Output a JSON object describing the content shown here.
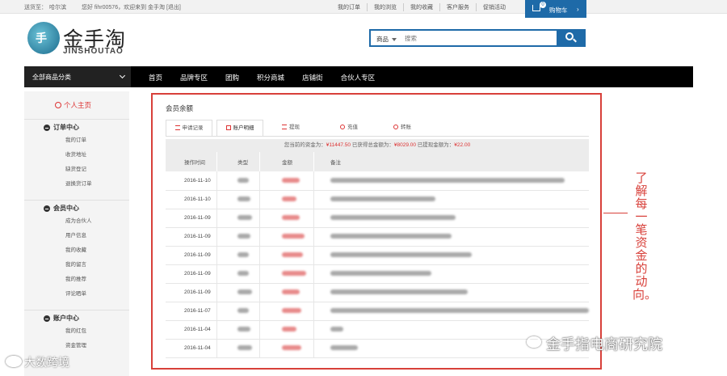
{
  "topbar": {
    "delivery_label": "送货至：",
    "location": "哈尔滨",
    "greeting": "您好 fihr00576，欢迎来到 金手淘 [退出]",
    "links": [
      "我的订单",
      "我的浏览",
      "我的收藏",
      "客户服务",
      "促销活动"
    ],
    "cart_label": "购物车",
    "cart_count": "0"
  },
  "logo": {
    "cn": "金手淘",
    "en": "JINSHOUTAO",
    "badge": "手"
  },
  "search": {
    "category": "商品",
    "placeholder": "搜索"
  },
  "nav": {
    "all_categories": "全部商品分类",
    "items": [
      "首页",
      "品牌专区",
      "团购",
      "积分商城",
      "店铺街",
      "合伙人专区"
    ]
  },
  "sidebar": {
    "home": "个人主页",
    "sections": [
      {
        "title": "订单中心",
        "items": [
          "我的订单",
          "收货地址",
          "缺货登记",
          "退换货订单"
        ]
      },
      {
        "title": "会员中心",
        "items": [
          "成为合伙人",
          "用户信息",
          "我的收藏",
          "我的留言",
          "我的推荐",
          "评论晒单"
        ]
      },
      {
        "title": "账户中心",
        "items": [
          "我的红包",
          "资金管理"
        ]
      }
    ]
  },
  "main": {
    "title": "会员余额",
    "tabs": [
      "申请记录",
      "账户明细",
      "提现",
      "充值",
      "转账"
    ],
    "summary_prefix": "您当前的资金为：",
    "balance": "¥11447.50",
    "summary_mid": " 已获得总金额为：",
    "total": "¥8029.00",
    "summary_mid2": " 已提现金额为：",
    "withdrawn": "¥22.00",
    "columns": [
      "操作时间",
      "类型",
      "金额",
      "备注"
    ],
    "rows": [
      {
        "date": "2016-11-10",
        "w2": 14,
        "w3": 22,
        "w4": 290
      },
      {
        "date": "2016-11-10",
        "w2": 16,
        "w3": 18,
        "w4": 130
      },
      {
        "date": "2016-11-09",
        "w2": 18,
        "w3": 22,
        "w4": 155
      },
      {
        "date": "2016-11-09",
        "w2": 16,
        "w3": 28,
        "w4": 150
      },
      {
        "date": "2016-11-09",
        "w2": 14,
        "w3": 26,
        "w4": 175
      },
      {
        "date": "2016-11-09",
        "w2": 14,
        "w3": 30,
        "w4": 125
      },
      {
        "date": "2016-11-09",
        "w2": 18,
        "w3": 22,
        "w4": 170
      },
      {
        "date": "2016-11-07",
        "w2": 14,
        "w3": 24,
        "w4": 320
      },
      {
        "date": "2016-11-04",
        "w2": 16,
        "w3": 18,
        "w4": 16
      },
      {
        "date": "2016-11-04",
        "w2": 18,
        "w3": 24,
        "w4": 34
      }
    ]
  },
  "callout": {
    "text": "了解每一笔资金的动向。"
  },
  "watermark": {
    "right": "金手指电商研究院",
    "left": "大数跨境"
  },
  "colors": {
    "brand_blue": "#1e6aa8",
    "accent_red": "#d8403a",
    "nav_black": "#000000"
  }
}
